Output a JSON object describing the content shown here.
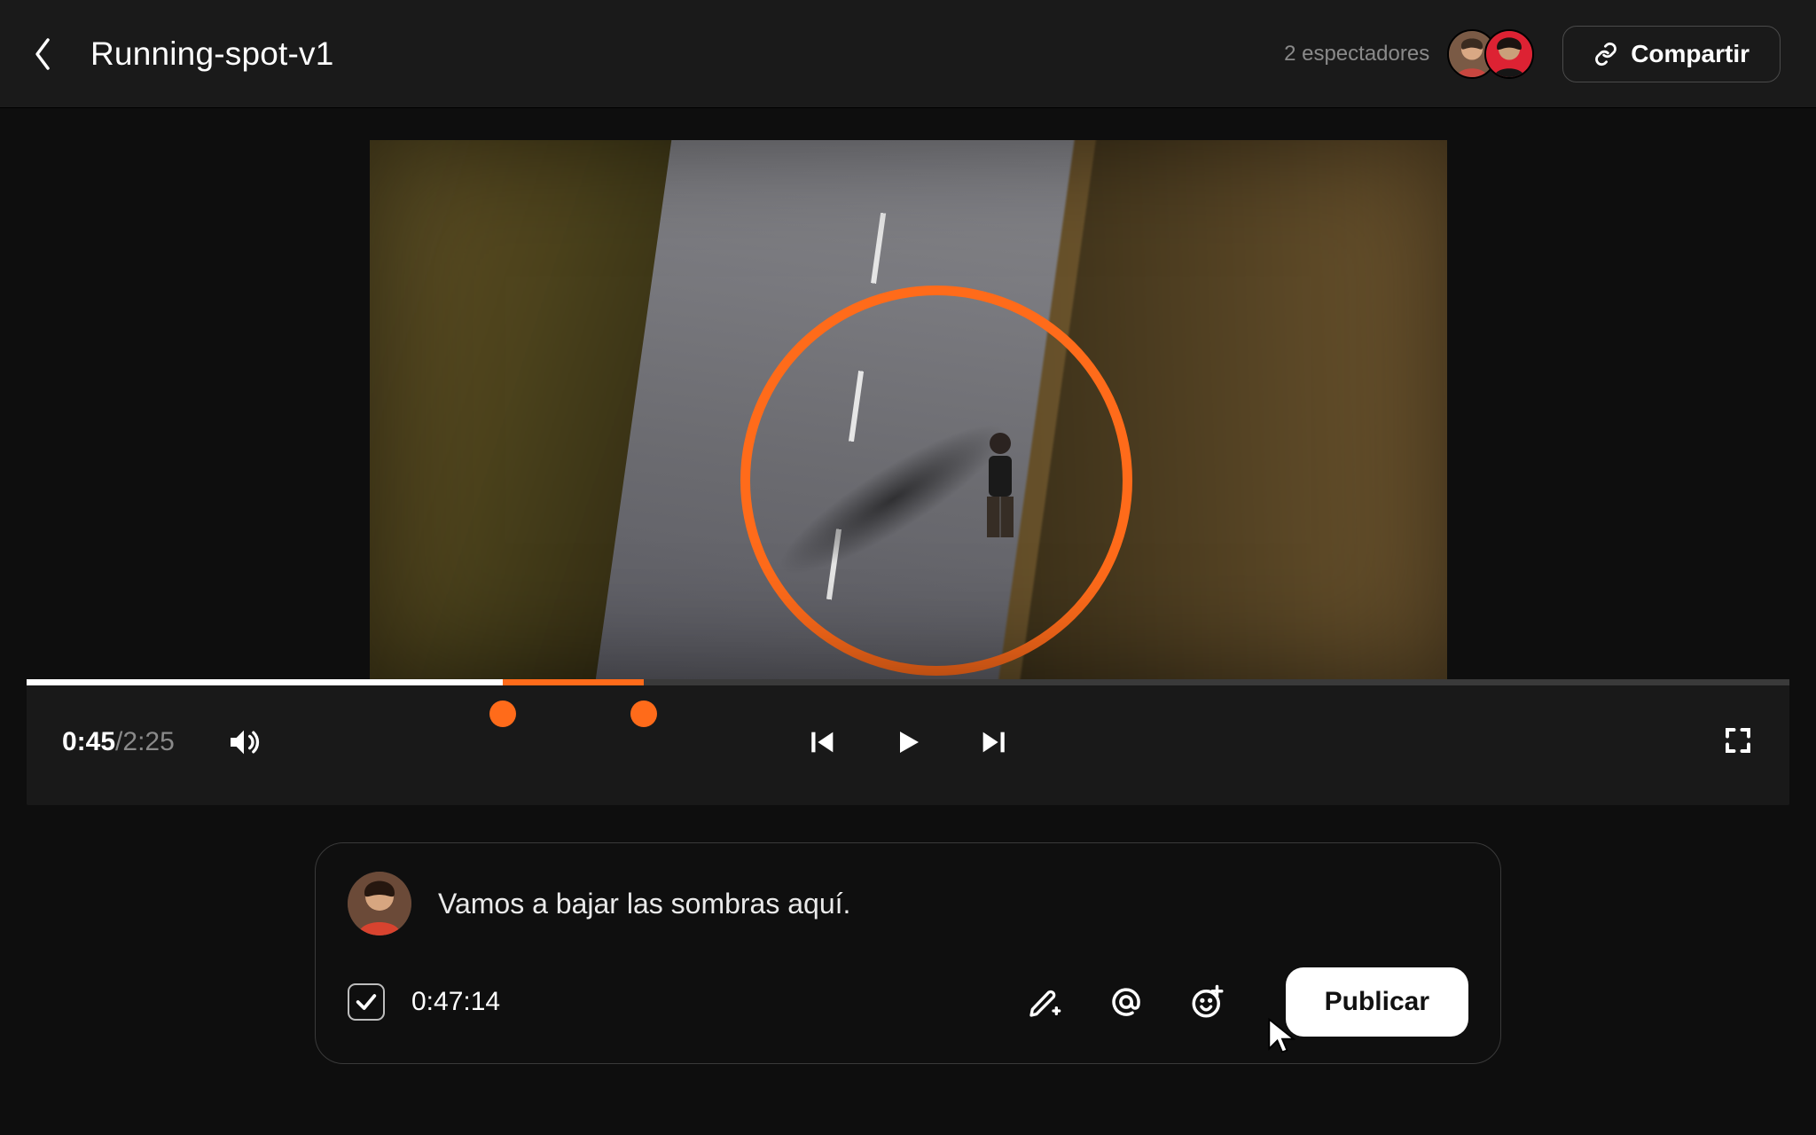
{
  "header": {
    "title": "Running-spot-v1",
    "viewers_label": "2 espectadores",
    "share_label": "Compartir"
  },
  "playback": {
    "current": "0:45",
    "duration": "2:25",
    "progress_white_pct": 27,
    "progress_accent_start_pct": 27,
    "progress_accent_end_pct": 35,
    "markers_pct": [
      27,
      35
    ]
  },
  "comment": {
    "text": "Vamos a bajar las sombras aquí.",
    "timestamp": "0:47:14",
    "timestamp_checked": true,
    "publish_label": "Publicar"
  }
}
